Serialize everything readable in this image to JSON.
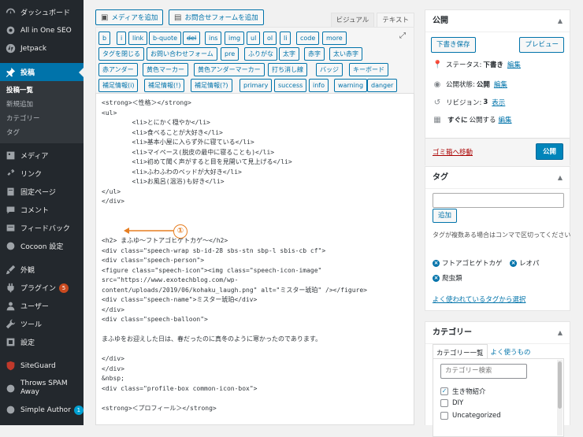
{
  "sidebar": {
    "items": [
      {
        "label": "ダッシュボード",
        "icon": "dashboard-icon"
      },
      {
        "label": "All in One SEO",
        "icon": "gear-icon"
      },
      {
        "label": "Jetpack",
        "icon": "jetpack-icon"
      },
      {
        "label": "投稿",
        "icon": "pin-icon",
        "active": true
      },
      {
        "label": "メディア",
        "icon": "media-icon"
      },
      {
        "label": "リンク",
        "icon": "link-icon"
      },
      {
        "label": "固定ページ",
        "icon": "page-icon"
      },
      {
        "label": "コメント",
        "icon": "comment-icon"
      },
      {
        "label": "フィードバック",
        "icon": "feedback-icon"
      },
      {
        "label": "Cocoon 設定",
        "icon": "cocoon-icon"
      },
      {
        "label": "外観",
        "icon": "brush-icon"
      },
      {
        "label": "プラグイン",
        "icon": "plugin-icon",
        "badge": "5"
      },
      {
        "label": "ユーザー",
        "icon": "user-icon"
      },
      {
        "label": "ツール",
        "icon": "wrench-icon"
      },
      {
        "label": "設定",
        "icon": "settings-icon"
      },
      {
        "label": "SiteGuard",
        "icon": "siteguard-icon"
      },
      {
        "label": "Throws SPAM Away",
        "icon": "spam-icon"
      },
      {
        "label": "Simple Author",
        "icon": "author-icon",
        "badge": "1"
      }
    ],
    "submenu": [
      "投稿一覧",
      "新規追加",
      "カテゴリー",
      "タグ"
    ]
  },
  "editor": {
    "add_media": "メディアを追加",
    "add_form": "お問合せフォームを追加",
    "tab_visual": "ビジュアル",
    "tab_text": "テキスト",
    "quicktags_row1": [
      "b",
      "i",
      "link",
      "b-quote",
      "del",
      "ins",
      "img",
      "ul",
      "ol",
      "li",
      "code",
      "more"
    ],
    "quicktags_row2": [
      "タグを閉じる",
      "お問い合わせフォーム",
      "pre",
      "ふりがな",
      "太字",
      "赤字",
      "太い赤字"
    ],
    "quicktags_row3": [
      "赤アンダー",
      "黄色マーカー",
      "黄色アンダーマーカー",
      "打ち消し線",
      "バッジ",
      "キーボード"
    ],
    "quicktags_row4": [
      "補足情報(i)",
      "補足情報(!)",
      "補足情報(?)",
      "primary",
      "success",
      "info",
      "warning",
      "danger"
    ],
    "code": "<strong>＜性格＞</strong>\n<ul>\n        <li>とにかく穏やか</li>\n        <li>食べることが大好き</li>\n        <li>基本小屋に入らず外に寝ている</li>\n        <li>マイペース(脱皮の最中に寝ることも)</li>\n        <li>初めて聞く声がすると目を見開いて見上げる</li>\n        <li>ふわふわのベッドが大好き</li>\n        <li>お風呂(温浴)も好き</li>\n</ul>\n</div>\n\n\n\n<h2> まふゆ～フトアゴヒゲトカゲ～</h2>\n<div class=\"speech-wrap sb-id-28 sbs-stn sbp-l sbis-cb cf\">\n<div class=\"speech-person\">\n<figure class=\"speech-icon\"><img class=\"speech-icon-image\"\nsrc=\"https://www.exotechblog.com/wp-\ncontent/uploads/2019/06/kohaku_laugh.png\" alt=\"ミスター琥珀\" /></figure>\n<div class=\"speech-name\">ミスター琥珀</div>\n</div>\n<div class=\"speech-balloon\">\n\nまふゆをお迎えした日は、春だったのに真冬のように寒かったのであります。\n\n</div>\n</div>\n&nbsp;\n<div class=\"profile-box common-icon-box\">\n\n<strong>＜プロフィール＞</strong>",
    "annotation_number": "①"
  },
  "publish": {
    "title": "公開",
    "save_draft": "下書き保存",
    "preview": "プレビュー",
    "status_label": "ステータス: ",
    "status_value": "下書き",
    "visibility_label": "公開状態: ",
    "visibility_value": "公開",
    "revision_label": "リビジョン: ",
    "revision_value": "3",
    "revision_link": "表示",
    "schedule_value": "すぐに",
    "schedule_label": "公開する",
    "edit": "編集",
    "trash": "ゴミ箱へ移動",
    "publish_btn": "公開"
  },
  "tags": {
    "title": "タグ",
    "add": "追加",
    "help": "タグが複数ある場合はコンマで区切ってください",
    "items": [
      "フトアゴヒゲトカゲ",
      "レオパ",
      "爬虫類"
    ],
    "popular": "よく使われているタグから選択"
  },
  "category": {
    "title": "カテゴリー",
    "tab_all": "カテゴリー一覧",
    "tab_popular": "よく使うもの",
    "search_placeholder": "カテゴリー検索",
    "items": [
      {
        "label": "生き物紹介",
        "checked": true
      },
      {
        "label": "DIY",
        "checked": false
      },
      {
        "label": "Uncategorized",
        "checked": false
      }
    ]
  },
  "colors": {
    "accent": "#0073aa",
    "sidebar": "#23282d",
    "annotation": "#e67e22"
  }
}
